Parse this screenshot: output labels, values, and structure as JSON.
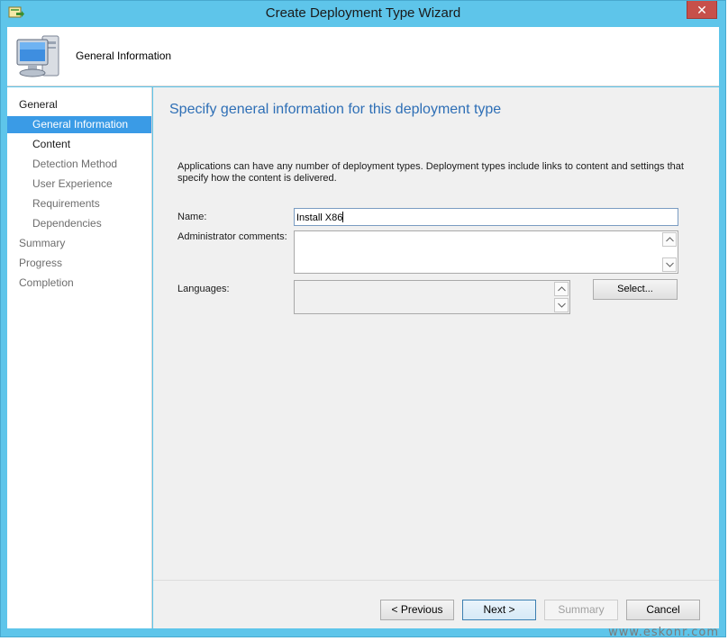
{
  "window": {
    "title": "Create Deployment Type Wizard",
    "close_glyph": "✕"
  },
  "header": {
    "title": "General Information",
    "icon": "computer-monitor-icon"
  },
  "sidebar": {
    "items": [
      {
        "label": "General",
        "active": false
      },
      {
        "label": "General Information",
        "active": true
      },
      {
        "label": "Content",
        "active": false
      },
      {
        "label": "Detection Method",
        "active": false
      },
      {
        "label": "User Experience",
        "active": false
      },
      {
        "label": "Requirements",
        "active": false
      },
      {
        "label": "Dependencies",
        "active": false
      },
      {
        "label": "Summary",
        "active": false
      },
      {
        "label": "Progress",
        "active": false
      },
      {
        "label": "Completion",
        "active": false
      }
    ]
  },
  "main": {
    "heading": "Specify general information for this deployment type",
    "description": "Applications can have any number of deployment types. Deployment types include links to content and settings that specify how the content is delivered.",
    "name_label": "Name:",
    "name_value": "Install X86",
    "admin_comments_label": "Administrator comments:",
    "admin_comments_value": "",
    "languages_label": "Languages:",
    "select_button": "Select..."
  },
  "footer": {
    "previous": "< Previous",
    "next": "Next >",
    "summary": "Summary",
    "cancel": "Cancel"
  },
  "watermark": "www.eskonr.com",
  "colors": {
    "titlebar": "#5ec5ea",
    "active_nav": "#3a9be6",
    "heading": "#2e6fb6",
    "close": "#c7504a"
  }
}
